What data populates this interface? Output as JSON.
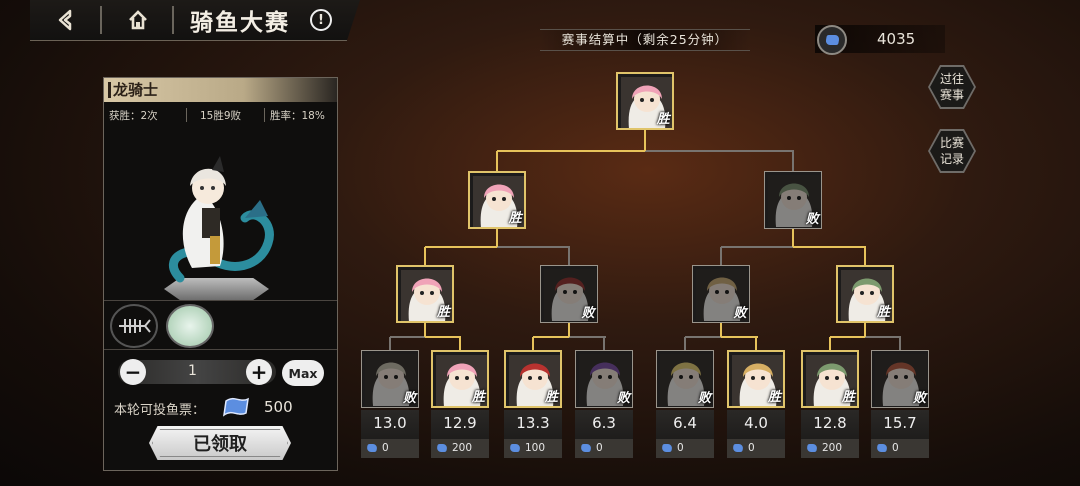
{
  "topbar": {
    "back_icon": "back-arrow-icon",
    "home_icon": "home-icon",
    "title": "骑鱼大赛",
    "info_symbol": "!"
  },
  "status": {
    "text": "赛事结算中（剩余25分钟）"
  },
  "currency": {
    "icon": "fish-ticket-icon",
    "value": "4035"
  },
  "side_buttons": [
    {
      "label": "过往\n赛事"
    },
    {
      "label": "比赛\n记录"
    }
  ],
  "panel": {
    "name": "龙骑士",
    "stats": {
      "wins": "获胜：2次",
      "record": "15胜9败",
      "rate": "胜率：18%"
    },
    "slots": [
      {
        "icon": "fishbone-icon"
      },
      {
        "icon": "pet-avatar-icon"
      }
    ],
    "stepper": {
      "value": "1",
      "minus": "−",
      "plus": "+",
      "max_label": "Max"
    },
    "tickets": {
      "label": "本轮可投鱼票：",
      "value": "500"
    },
    "claim_label": "已领取"
  },
  "colors": {
    "accent_gold": "#e7c35b",
    "win_line": "#e7c35b",
    "lose_line": "#787470",
    "flag_blue": "#5c8ee0"
  },
  "bracket": {
    "final": {
      "result": "胜",
      "color": "#f0a3b8"
    },
    "semis": [
      {
        "result": "胜",
        "color": "#f0a3b8"
      },
      {
        "result": "败",
        "color": "#7c9a6e"
      }
    ],
    "quarters": [
      {
        "result": "胜",
        "color": "#f0a3b8"
      },
      {
        "result": "败",
        "color": "#b8322f"
      },
      {
        "result": "败",
        "color": "#d6ae63"
      },
      {
        "result": "胜",
        "color": "#7c9a6e"
      }
    ],
    "first_round": [
      {
        "result": "败",
        "odds": "13.0",
        "bet": "0",
        "color": "#c9c2a8"
      },
      {
        "result": "胜",
        "odds": "12.9",
        "bet": "200",
        "color": "#f0a3b8"
      },
      {
        "result": "胜",
        "odds": "13.3",
        "bet": "100",
        "color": "#b8322f"
      },
      {
        "result": "败",
        "odds": "6.3",
        "bet": "0",
        "color": "#8c4fc4"
      },
      {
        "result": "败",
        "odds": "6.4",
        "bet": "0",
        "color": "#f0cf56"
      },
      {
        "result": "胜",
        "odds": "4.0",
        "bet": "0",
        "color": "#d6ae63"
      },
      {
        "result": "胜",
        "odds": "12.8",
        "bet": "200",
        "color": "#7c9a6e"
      },
      {
        "result": "败",
        "odds": "15.7",
        "bet": "0",
        "color": "#d35a35"
      }
    ]
  }
}
